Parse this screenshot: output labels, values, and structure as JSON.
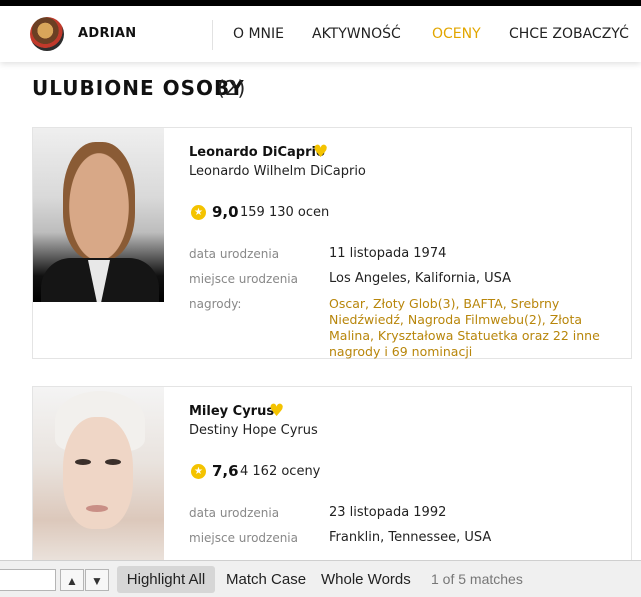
{
  "header": {
    "username": "ADRIAN",
    "nav": [
      "O MNIE",
      "AKTYWNOŚĆ",
      "OCENY",
      "CHCE ZOBACZYĆ"
    ],
    "active_nav": "OCENY",
    "accent_color": "#e2a600"
  },
  "section": {
    "title": "ULUBIONE OSOBY",
    "count": "(2)"
  },
  "people": [
    {
      "name": "Leonardo DiCaprio",
      "full_name": "Leonardo Wilhelm DiCaprio",
      "rating": "9,0",
      "votes": "159 130 ocen",
      "birth_date_label": "data urodzenia",
      "birth_date": "11 listopada 1974",
      "birth_place_label": "miejsce urodzenia",
      "birth_place": "Los Angeles, Kalifornia, USA",
      "awards_label": "nagrody:",
      "awards": "Oscar, Złoty Glob(3), BAFTA, Srebrny Niedźwiedź, Nagroda Filmwebu(2), Złota Malina, Kryształowa Statuetka oraz 22 inne nagrody i 69 nominacji"
    },
    {
      "name": "Miley Cyrus",
      "full_name": "Destiny Hope Cyrus",
      "rating": "7,6",
      "votes": "4 162 oceny",
      "birth_date_label": "data urodzenia",
      "birth_date": "23 listopada 1992",
      "birth_place_label": "miejsce urodzenia",
      "birth_place": "Franklin, Tennessee, USA"
    }
  ],
  "findbar": {
    "search_value": "",
    "highlight_all": "Highlight All",
    "match_case": "Match Case",
    "whole_words": "Whole Words",
    "status": "1 of 5 matches"
  }
}
